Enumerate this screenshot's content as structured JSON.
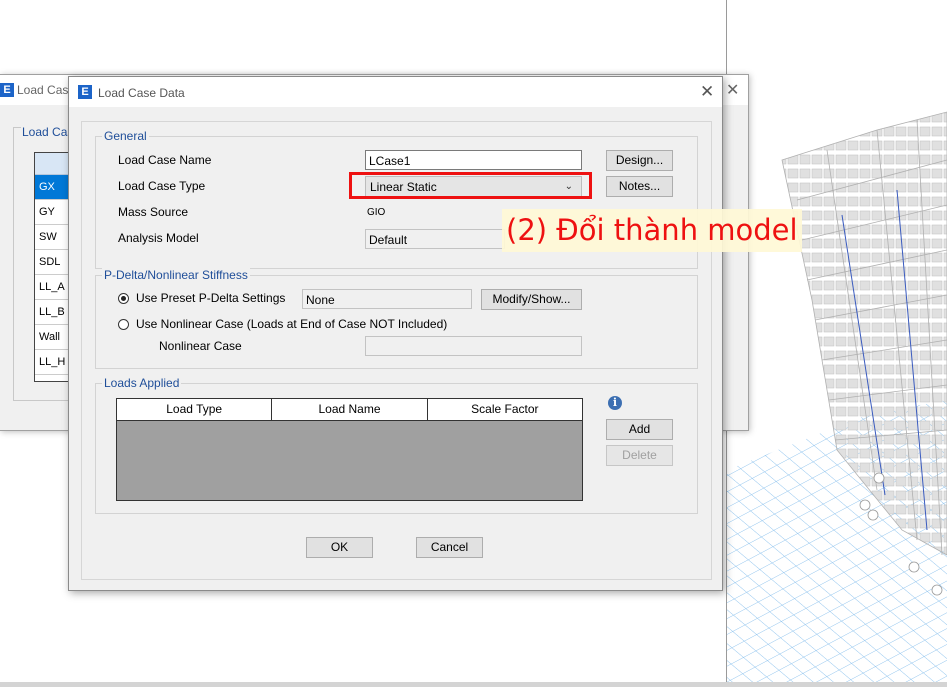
{
  "back_window": {
    "title": "Load Case",
    "group_title": "Load Case",
    "items": [
      {
        "label": "GX",
        "selected": true
      },
      {
        "label": "GY"
      },
      {
        "label": "SW"
      },
      {
        "label": "SDL"
      },
      {
        "label": "LL_A"
      },
      {
        "label": "LL_B"
      },
      {
        "label": "Wall"
      },
      {
        "label": "LL_H"
      }
    ],
    "close_glyph": "✕"
  },
  "dialog": {
    "title": "Load Case Data",
    "close_glyph": "✕",
    "logo_letter": "E",
    "general": {
      "title": "General",
      "name_label": "Load Case Name",
      "name_value": "LCase1",
      "type_label": "Load Case Type",
      "type_value": "Linear Static",
      "mass_label": "Mass Source",
      "mass_value": "GIO",
      "model_label": "Analysis Model",
      "model_value": "Default",
      "design_button": "Design...",
      "notes_button": "Notes..."
    },
    "pdelta": {
      "title": "P-Delta/Nonlinear Stiffness",
      "preset_label": "Use Preset P-Delta Settings",
      "preset_value": "None",
      "preset_selected": true,
      "modify_button": "Modify/Show...",
      "nonlinear_label": "Use Nonlinear Case  (Loads at End of Case NOT Included)",
      "nonlinear_case_label": "Nonlinear Case",
      "nonlinear_case_value": ""
    },
    "loads": {
      "title": "Loads Applied",
      "columns": [
        "Load Type",
        "Load Name",
        "Scale Factor"
      ],
      "add_button": "Add",
      "delete_button": "Delete",
      "info_icon": "info-icon"
    },
    "ok_button": "OK",
    "cancel_button": "Cancel"
  },
  "annotation": {
    "text": "(2) Đổi thành model",
    "color": "#ee1111"
  }
}
